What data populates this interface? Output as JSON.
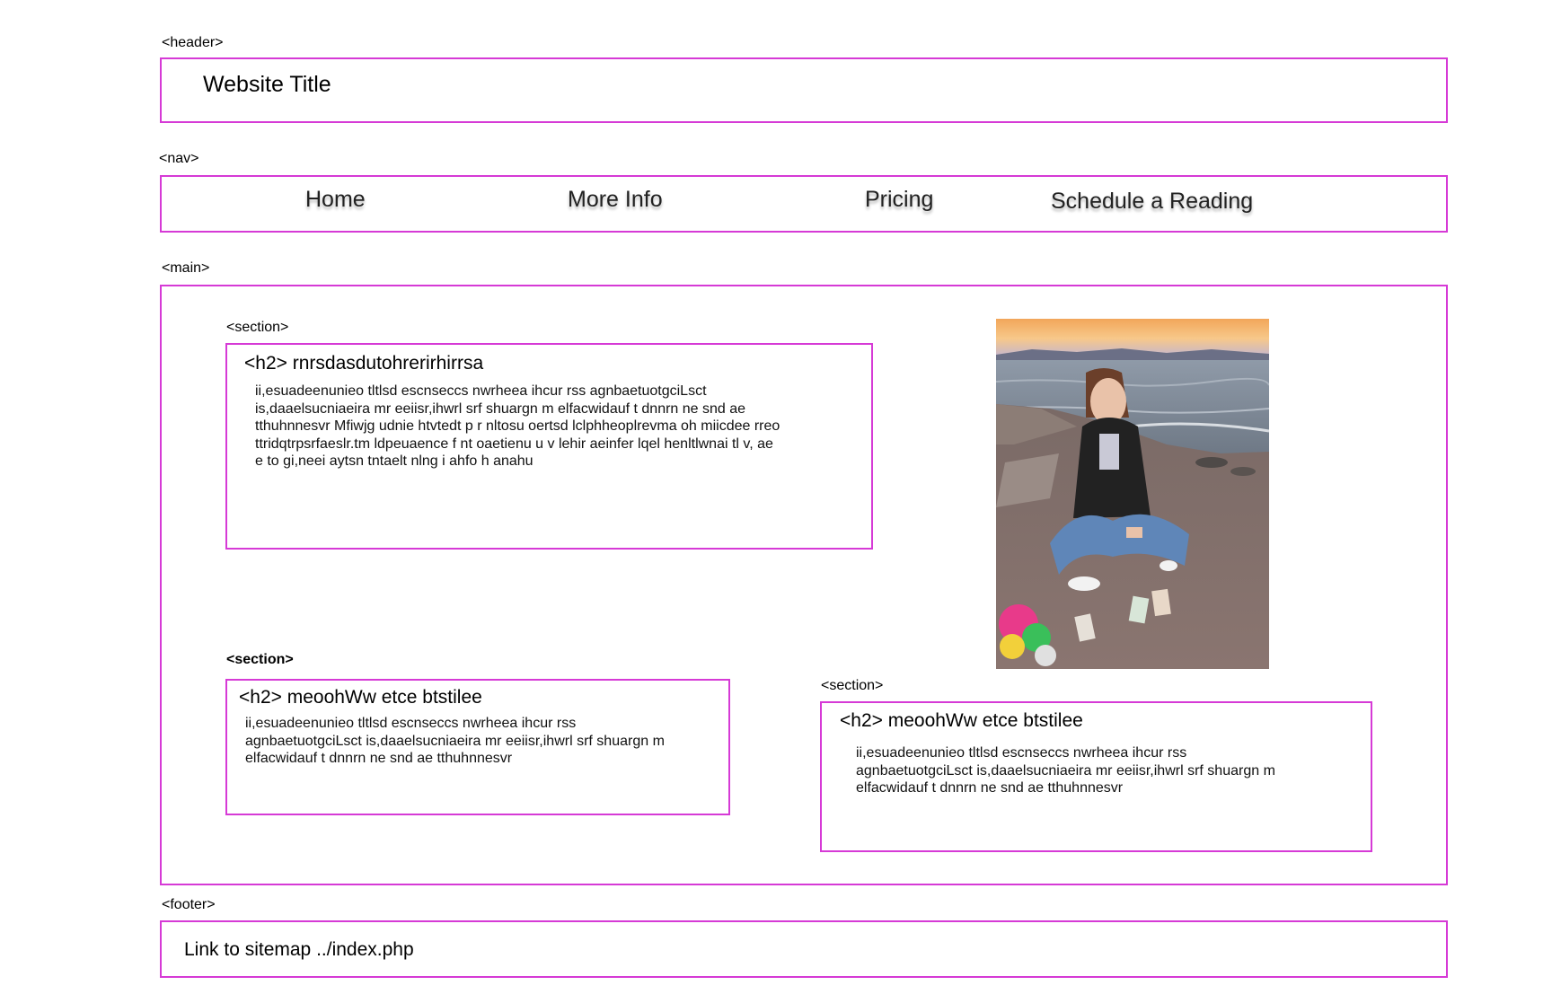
{
  "tags": {
    "header": "<header>",
    "nav": "<nav>",
    "main": "<main>",
    "section1": "<section>",
    "section2": "<section>",
    "section3": "<section>",
    "footer": "<footer>"
  },
  "header": {
    "title": "Website Title"
  },
  "nav": {
    "items": [
      {
        "label": "Home"
      },
      {
        "label": "More Info"
      },
      {
        "label": "Pricing"
      },
      {
        "label": "Schedule a Reading"
      }
    ]
  },
  "main": {
    "sections": [
      {
        "heading": "<h2> rnrsdasdutohrerirhirrsa",
        "lines": [
          "ii,esuadeenunieo tltlsd escnseccs nwrheea ihcur rss agnbaetuotgciLsct",
          "is,daaelsucniaeira mr eeiisr,ihwrl srf shuargn m  elfacwidauf t  dnnrn ne snd ae",
          "tthuhnnesvr Mfiwjg  udnie htvtedt p r nltosu oertsd lclphheoplrevma oh  miicdee rreo",
          "ttridqtrpsrfaeslr.tm ldpeuaence f nt oaetienu u   v  lehir aeinfer lqel henltlwnai tl v,  ae",
          "e to gi,neei aytsn tntaelt nlng i ahfo h anahu"
        ]
      },
      {
        "heading": "<h2> meoohWw etce btstilee",
        "lines": [
          "ii,esuadeenunieo tltlsd escnseccs nwrheea ihcur rss",
          "agnbaetuotgciLsct is,daaelsucniaeira mr eeiisr,ihwrl srf shuargn m",
          "elfacwidauf t  dnnrn ne snd ae tthuhnnesvr"
        ]
      },
      {
        "heading": "<h2> meoohWw etce btstilee",
        "lines": [
          "ii,esuadeenunieo tltlsd escnseccs nwrheea ihcur rss",
          "agnbaetuotgciLsct is,daaelsucniaeira mr eeiisr,ihwrl srf shuargn m",
          "elfacwidauf t  dnnrn ne snd ae tthuhnnesvr"
        ]
      }
    ]
  },
  "footer": {
    "link": "Link to sitemap ../index.php"
  },
  "colors": {
    "outline": "#d63ad6"
  }
}
